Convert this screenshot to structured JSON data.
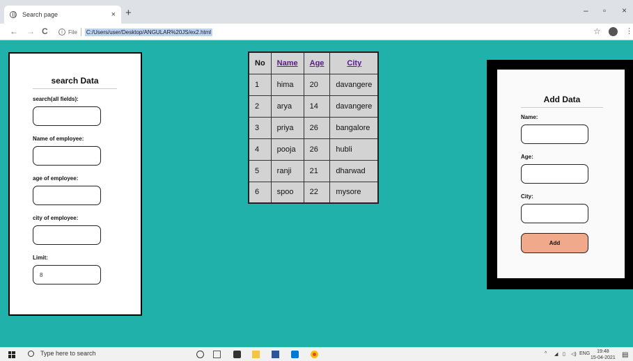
{
  "browser": {
    "tab_title": "Search page",
    "tab_close": "×",
    "new_tab": "+",
    "file_label": "File",
    "url": "C:/Users/user/Desktop/ANGULAR%20JS/ex2.html",
    "window_controls": [
      "–",
      "▫",
      "×"
    ],
    "nav": {
      "back": "←",
      "forward": "→",
      "reload": "C"
    }
  },
  "search_panel": {
    "heading": "search Data",
    "fields": [
      {
        "label": "search(all fields):",
        "value": ""
      },
      {
        "label": "Name of employee:",
        "value": ""
      },
      {
        "label": "age of employee:",
        "value": ""
      },
      {
        "label": "city of employee:",
        "value": ""
      },
      {
        "label": "Limit:",
        "value": "8"
      }
    ]
  },
  "table": {
    "headers": {
      "no": "No",
      "name": "Name",
      "age": "Age",
      "city": "City"
    },
    "rows": [
      {
        "no": "1",
        "name": "hima",
        "age": "20",
        "city": "davangere"
      },
      {
        "no": "2",
        "name": "arya",
        "age": "14",
        "city": "davangere"
      },
      {
        "no": "3",
        "name": "priya",
        "age": "26",
        "city": "bangalore"
      },
      {
        "no": "4",
        "name": "pooja",
        "age": "26",
        "city": "hubli"
      },
      {
        "no": "5",
        "name": "ranji",
        "age": "21",
        "city": "dharwad"
      },
      {
        "no": "6",
        "name": "spoo",
        "age": "22",
        "city": "mysore"
      }
    ]
  },
  "add_panel": {
    "heading": "Add Data",
    "name_label": "Name:",
    "age_label": "Age:",
    "city_label": "City:",
    "button_label": "Add"
  },
  "taskbar": {
    "search_placeholder": "Type here to search",
    "lang": "ENG",
    "time": "19:48",
    "date": "15-04-2021"
  },
  "colors": {
    "page_bg": "#20b2aa",
    "add_button_bg": "#f0a98a",
    "table_cell_bg": "#d3d3d3",
    "link": "#551a8b"
  }
}
